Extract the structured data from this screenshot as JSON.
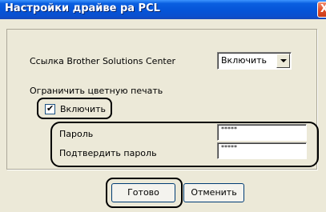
{
  "window": {
    "title": "Настройки драйве ра PCL",
    "close_glyph": "X"
  },
  "brother_solutions": {
    "label": "Ссылка Brother Solutions Center",
    "selected": "Включить"
  },
  "color_restrict": {
    "label": "Ограничить цветную печать",
    "enable_label": "Включить",
    "enabled": true
  },
  "password": {
    "label": "Пароль",
    "value": "*****"
  },
  "confirm_password": {
    "label": "Подтвердить пароль",
    "value": "*****"
  },
  "buttons": {
    "ok_label": "Готово",
    "cancel_label": "Отменить"
  },
  "colors": {
    "title_bar": "#0554d8",
    "dialog_background": "#ece9d8",
    "close_button": "#e0502a",
    "highlight_outline": "#000000"
  }
}
